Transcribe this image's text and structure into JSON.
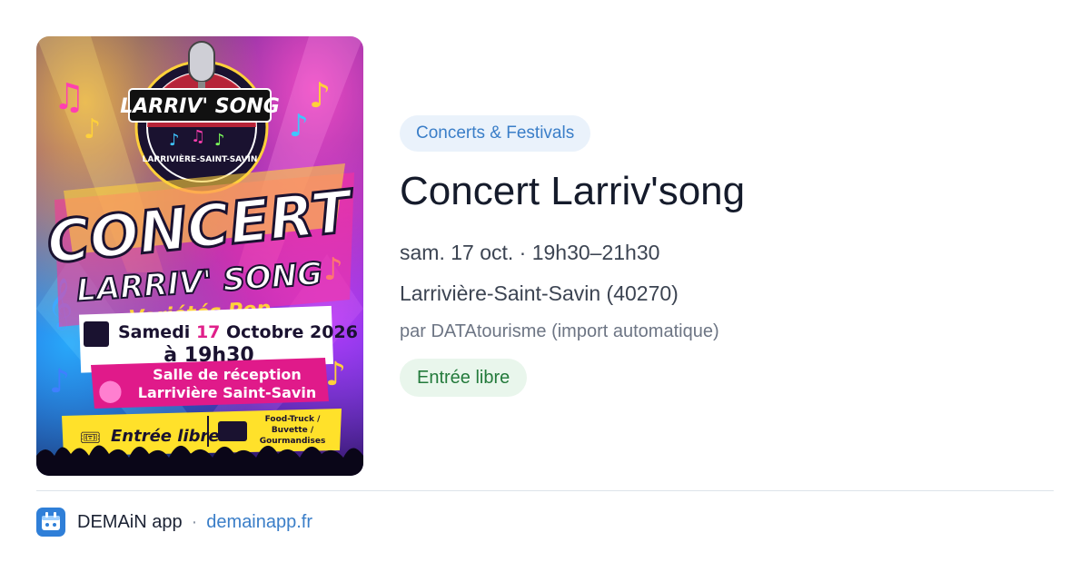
{
  "poster": {
    "badge_top": "LARRIV' SONG",
    "badge_ring": "LARRIVIÈRE-SAINT-SAVIN",
    "headline": "CONCERT",
    "subheadline": "LARRIV' SONG",
    "genre": "Variétés Pop",
    "date_prefix": "Samedi",
    "date_day": "17",
    "date_suffix": "Octobre 2026",
    "time": "à 19h30",
    "venue_line1": "Salle de réception",
    "venue_line2": "Larrivière Saint-Savin",
    "entry": "Entrée libre",
    "food_line1": "Food-Truck /",
    "food_line2": "Buvette /",
    "food_line3": "Gourmandises"
  },
  "event": {
    "category": "Concerts & Festivals",
    "title": "Concert Larriv'song",
    "when": "sam. 17 oct. · 19h30–21h30",
    "where": "Larrivière-Saint-Savin (40270)",
    "by": "par DATAtourisme (import automatique)",
    "price": "Entrée libre"
  },
  "footer": {
    "app_name": "DEMAiN app",
    "separator": "·",
    "site": "demainapp.fr"
  },
  "colors": {
    "category_bg": "#eaf2fb",
    "category_text": "#3a7ec8",
    "price_bg": "#e9f6ec",
    "price_text": "#237a3b",
    "link": "#3a7ec8",
    "app_icon": "#2f7fd8"
  }
}
